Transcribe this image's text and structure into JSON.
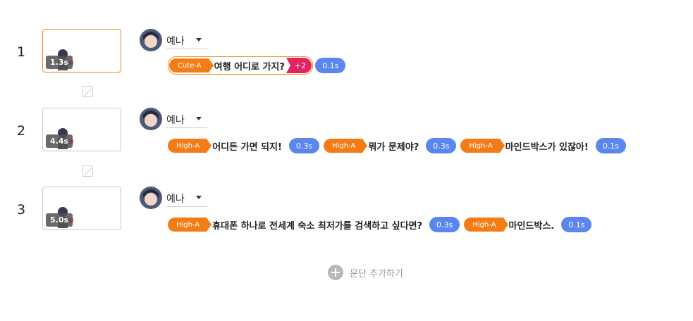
{
  "paragraphs": [
    {
      "number": "1",
      "duration": "1.3s",
      "speaker": "예나",
      "segments": [
        {
          "voice": "Cute-A",
          "text": "여행 어디로 가지?",
          "extra": "+2",
          "pause": "0.1s"
        }
      ]
    },
    {
      "number": "2",
      "duration": "4.4s",
      "speaker": "예나",
      "segments": [
        {
          "voice": "High-A",
          "text": "어디든 가면 되지!",
          "pause": "0.3s"
        },
        {
          "voice": "High-A",
          "text": "뭐가 문제야?",
          "pause": "0.3s"
        },
        {
          "voice": "High-A",
          "text": "마인드박스가 있잖아!",
          "pause": "0.1s"
        }
      ]
    },
    {
      "number": "3",
      "duration": "5.0s",
      "speaker": "예나",
      "segments": [
        {
          "voice": "High-A",
          "text": "휴대폰 하나로 전세계 숙소 최저가를 검색하고 싶다면?",
          "pause": "0.3s"
        },
        {
          "voice": "High-A",
          "text": "마인드박스.",
          "pause": "0.1s"
        }
      ]
    }
  ],
  "add_paragraph_label": "문단 추가하기",
  "colors": {
    "accent_orange": "#f47c16",
    "pause_blue": "#5b86f0",
    "extra_pink": "#e0245e"
  }
}
